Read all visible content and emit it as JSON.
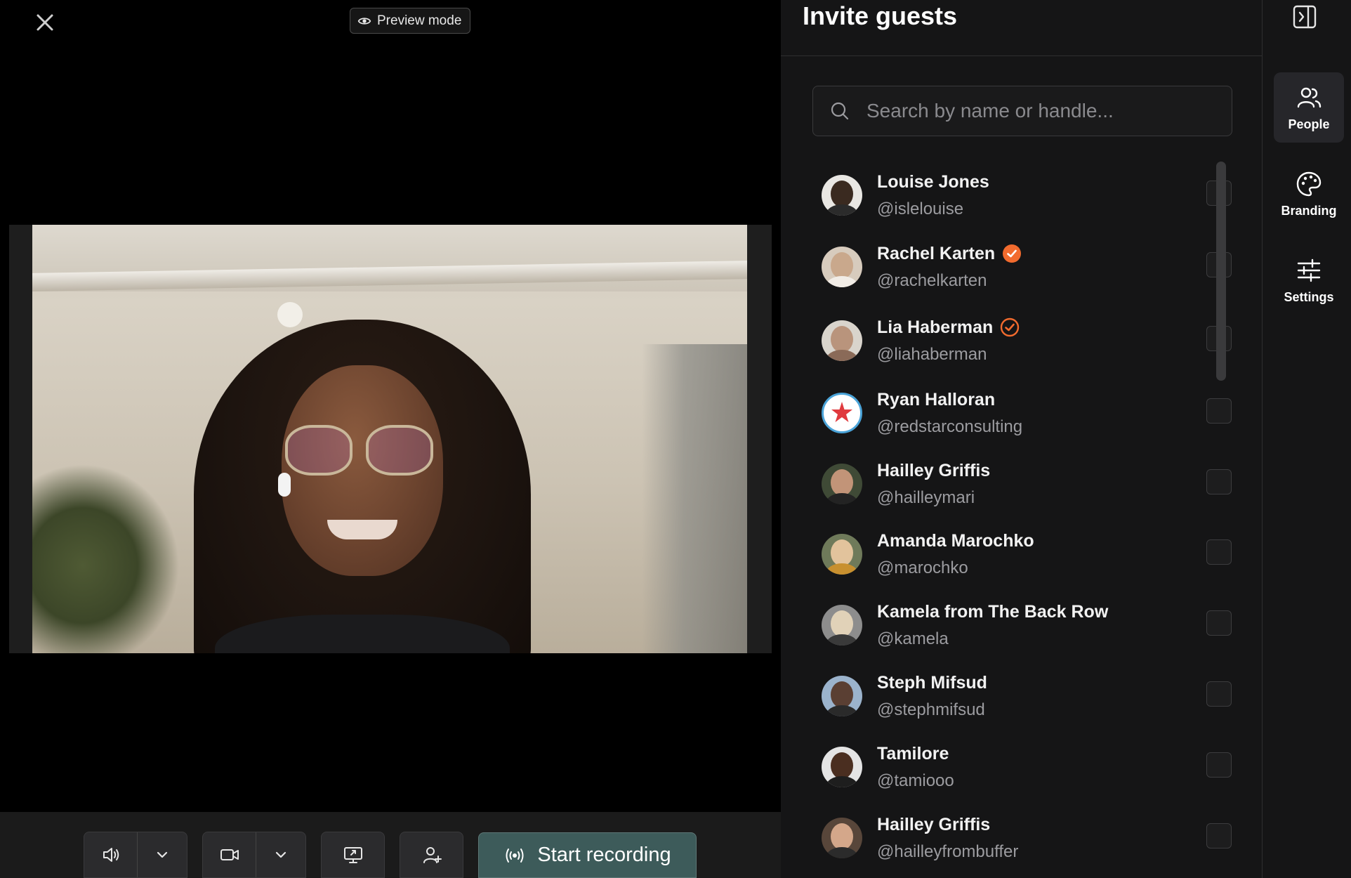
{
  "stage": {
    "preview_label": "Preview mode"
  },
  "toolbar": {
    "record_label": "Start recording",
    "record_color": "#3d5b5a"
  },
  "panel": {
    "title": "Invite guests",
    "search_placeholder": "Search by name or handle...",
    "accent_color": "#f26b2e",
    "guests": [
      {
        "name": "Louise Jones",
        "handle": "@islelouise",
        "verified": false,
        "checked": false
      },
      {
        "name": "Rachel Karten",
        "handle": "@rachelkarten",
        "verified": true,
        "verified_style": "filled",
        "checked": false
      },
      {
        "name": "Lia Haberman",
        "handle": "@liahaberman",
        "verified": true,
        "verified_style": "outline",
        "checked": false
      },
      {
        "name": "Ryan Halloran",
        "handle": "@redstarconsulting",
        "verified": false,
        "checked": false
      },
      {
        "name": "Hailley Griffis",
        "handle": "@hailleymari",
        "verified": false,
        "checked": false
      },
      {
        "name": "Amanda Marochko",
        "handle": "@marochko",
        "verified": false,
        "checked": false
      },
      {
        "name": "Kamela from The Back Row",
        "handle": "@kamela",
        "verified": false,
        "checked": false
      },
      {
        "name": "Steph Mifsud",
        "handle": "@stephmifsud",
        "verified": false,
        "checked": false
      },
      {
        "name": "Tamilore",
        "handle": "@tamiooo",
        "verified": false,
        "checked": false
      },
      {
        "name": "Hailley Griffis",
        "handle": "@hailleyfrombuffer",
        "verified": false,
        "checked": false
      }
    ]
  },
  "rail": {
    "items": [
      {
        "label": "People",
        "icon": "people-icon",
        "active": true
      },
      {
        "label": "Branding",
        "icon": "palette-icon",
        "active": false
      },
      {
        "label": "Settings",
        "icon": "sliders-icon",
        "active": false
      }
    ]
  }
}
